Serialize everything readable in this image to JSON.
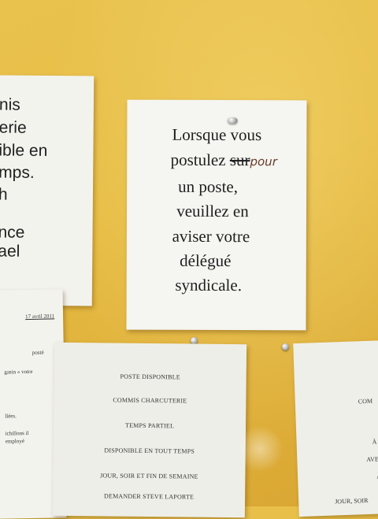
{
  "main_note": {
    "lines": [
      "Lorsque vous",
      "postulez",
      "sur",
      "pour",
      "un poste,",
      "veuillez en",
      "aviser votre",
      "délégué",
      "syndicale",
      "."
    ]
  },
  "left_sheet": {
    "lines": [
      "nis",
      "erie",
      "ible en",
      "mps.",
      "h",
      "nce",
      "ael"
    ]
  },
  "bottom_left_sheet": {
    "lines": [
      "17 avril 2011",
      "postè",
      "gasin « votre",
      "llées.",
      "ichillons il",
      "employé"
    ]
  },
  "bottom_center_sheet": {
    "lines": [
      "POSTE DISPONIBLE",
      "COMMIS CHARCUTERIE",
      "TEMPS PARTIEL",
      "DISPONIBLE EN TOUT TEMPS",
      "JOUR, SOIR ET FIN DE SEMAINE",
      "DEMANDER STEVE LAPORTE"
    ]
  },
  "bottom_right_sheet": {
    "lines": [
      "COM",
      "À",
      "AVE",
      "À",
      "JOUR, SOIR"
    ]
  },
  "colors": {
    "wall": "#e6bb42",
    "paper": "#f5f5f1",
    "handwriting": "#6a3b2a"
  }
}
